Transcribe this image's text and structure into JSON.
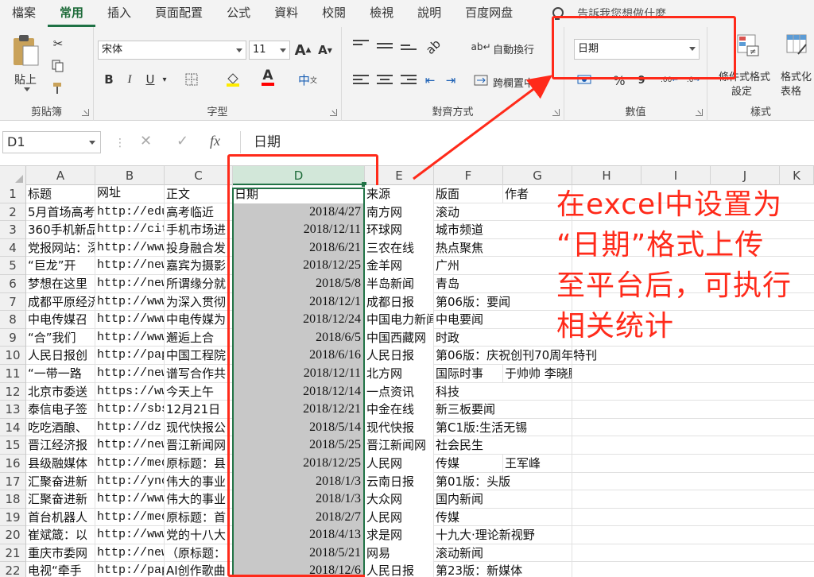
{
  "tabs": [
    "檔案",
    "常用",
    "插入",
    "頁面配置",
    "公式",
    "資料",
    "校閱",
    "檢視",
    "說明",
    "百度网盘"
  ],
  "active_tab": "常用",
  "tell_me": "告訴我您想做什麼",
  "ribbon": {
    "clipboard": {
      "label": "剪貼簿",
      "paste": "貼上"
    },
    "font": {
      "label": "字型",
      "name": "宋体",
      "size": "11",
      "bold": "B",
      "italic": "I",
      "underline": "U",
      "grow": "A",
      "shrink": "A",
      "font_color": "A",
      "phonetic": "中"
    },
    "alignment": {
      "label": "對齊方式",
      "wrap": "自動換行",
      "merge": "跨欄置中"
    },
    "number": {
      "label": "數值",
      "format": "日期",
      "percent": "%",
      "comma": "9",
      "inc": ".00",
      "dec": ".0"
    },
    "styles": {
      "label": "樣式",
      "conditional_1": "條件式格式",
      "conditional_2": "設定",
      "table_1": "格式化",
      "table_2": "表格"
    }
  },
  "formula_bar": {
    "name_box": "D1",
    "cancel": "✕",
    "enter": "✓",
    "fx": "fx",
    "content": "日期"
  },
  "columns": [
    "A",
    "B",
    "C",
    "D",
    "E",
    "F",
    "G",
    "H",
    "I",
    "J",
    "K"
  ],
  "rows": [
    {
      "n": "1",
      "a": "标题",
      "b": "网址",
      "c": "正文",
      "d": "日期",
      "e": "来源",
      "f": "版面",
      "g": "作者"
    },
    {
      "n": "2",
      "a": "5月首场高考",
      "b": "http://edu",
      "c": "高考临近",
      "d": "2018/4/27",
      "e": "南方网",
      "f": "滚动",
      "g": ""
    },
    {
      "n": "3",
      "a": "360手机新品",
      "b": "http://cit",
      "c": "手机市场进",
      "d": "2018/12/11",
      "e": "环球网",
      "f": "城市频道",
      "g": ""
    },
    {
      "n": "4",
      "a": "党报网站：深",
      "b": "http://www",
      "c": "投身融合发",
      "d": "2018/6/21",
      "e": "三农在线",
      "f": "热点聚焦",
      "g": ""
    },
    {
      "n": "5",
      "a": "“巨龙”开",
      "b": "http://new",
      "c": "嘉宾为摄影",
      "d": "2018/12/25",
      "e": "金羊网",
      "f": "广州",
      "g": ""
    },
    {
      "n": "6",
      "a": "梦想在这里",
      "b": "http://new",
      "c": "所谓缘分就",
      "d": "2018/5/8",
      "e": "半岛新闻",
      "f": "青岛",
      "g": ""
    },
    {
      "n": "7",
      "a": "成都平原经济",
      "b": "http://www",
      "c": "为深入贯彻",
      "d": "2018/12/1",
      "e": "成都日报",
      "f": "第06版：要闻",
      "g": ""
    },
    {
      "n": "8",
      "a": "中电传媒召",
      "b": "http://www",
      "c": "中电传媒为",
      "d": "2018/12/24",
      "e": "中国电力新闻",
      "f": "中电要闻",
      "g": ""
    },
    {
      "n": "9",
      "a": "“合”我们",
      "b": "http://www",
      "c": "邂逅上合",
      "d": "2018/6/5",
      "e": "中国西藏网",
      "f": "时政",
      "g": ""
    },
    {
      "n": "10",
      "a": "人民日报创",
      "b": "http://pap",
      "c": "中国工程院",
      "d": "2018/6/16",
      "e": "人民日报",
      "f": "第06版：庆祝创刊70周年特刊",
      "g": ""
    },
    {
      "n": "11",
      "a": "“一带一路",
      "b": "http://new",
      "c": "谱写合作共",
      "d": "2018/12/11",
      "e": "北方网",
      "f": "国际时事",
      "g": "于帅帅 李晓鹏"
    },
    {
      "n": "12",
      "a": "北京市委送",
      "b": "https://ww",
      "c": "今天上午",
      "d": "2018/12/14",
      "e": "一点资讯",
      "f": "科技",
      "g": ""
    },
    {
      "n": "13",
      "a": "泰信电子签",
      "b": "http://sbs",
      "c": "12月21日",
      "d": "2018/12/21",
      "e": "中金在线",
      "f": "新三板要闻",
      "g": ""
    },
    {
      "n": "14",
      "a": "吃吃酒酿、",
      "b": "http://dz.",
      "c": "现代快报公",
      "d": "2018/5/14",
      "e": "现代快报",
      "f": "第C1版:生活无锡",
      "g": ""
    },
    {
      "n": "15",
      "a": "晋江经济报",
      "b": "http://new",
      "c": "晋江新闻网",
      "d": "2018/5/25",
      "e": "晋江新闻网",
      "f": "社会民生",
      "g": ""
    },
    {
      "n": "16",
      "a": "县级融媒体",
      "b": "http://med",
      "c": "原标题：县",
      "d": "2018/12/25",
      "e": "人民网",
      "f": "传媒",
      "g": "王军峰"
    },
    {
      "n": "17",
      "a": "汇聚奋进新",
      "b": "http://ync",
      "c": "伟大的事业",
      "d": "2018/1/3",
      "e": "云南日报",
      "f": "第01版：头版",
      "g": ""
    },
    {
      "n": "18",
      "a": "汇聚奋进新",
      "b": "http://www",
      "c": "伟大的事业",
      "d": "2018/1/3",
      "e": "大众网",
      "f": "国内新闻",
      "g": ""
    },
    {
      "n": "19",
      "a": "首台机器人",
      "b": "http://med",
      "c": "原标题：首",
      "d": "2018/2/7",
      "e": "人民网",
      "f": "传媒",
      "g": ""
    },
    {
      "n": "20",
      "a": "崔斌箴：以",
      "b": "http://www",
      "c": "党的十八大",
      "d": "2018/4/13",
      "e": "求是网",
      "f": "十九大·理论新视野",
      "g": ""
    },
    {
      "n": "21",
      "a": "重庆市委网",
      "b": "http://new",
      "c": "（原标题：",
      "d": "2018/5/21",
      "e": "网易",
      "f": "滚动新闻",
      "g": ""
    },
    {
      "n": "22",
      "a": "电视“牵手",
      "b": "http://pap",
      "c": "AI创作歌曲",
      "d": "2018/12/6",
      "e": "人民日报",
      "f": "第23版：新媒体",
      "g": ""
    }
  ],
  "annotation": {
    "lines": [
      "在excel中设置为",
      "“日期”格式上传",
      "至平台后，可执行",
      "相关统计"
    ],
    "color": "#ff2a1a"
  },
  "colors": {
    "accent": "#217346",
    "ribbon_bg": "#f3f3f3",
    "selection": "#c8c8c8"
  }
}
